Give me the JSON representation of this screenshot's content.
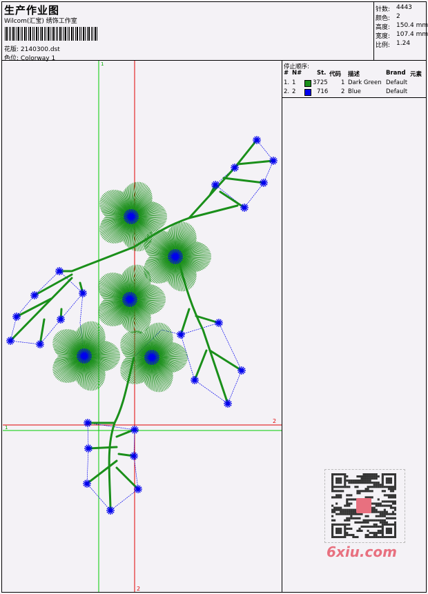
{
  "header": {
    "title": "生产作业图",
    "studio": "Wilcom(汇宝) 绣饰工作室",
    "design_label": "花版:",
    "design_value": "2140300.dst",
    "colorway_label": "色位:",
    "colorway_value": "Colorway 1"
  },
  "stats": [
    {
      "label": "针数:",
      "value": "4443"
    },
    {
      "label": "颜色:",
      "value": "2"
    },
    {
      "label": "高度:",
      "value": "150.4 mm"
    },
    {
      "label": "宽度:",
      "value": "107.4 mm"
    },
    {
      "label": "比例:",
      "value": "1.24"
    }
  ],
  "stop_sequence": {
    "title": "停止顺序:",
    "columns": [
      "#",
      "N#",
      "St.",
      "代码",
      "描述",
      "Brand",
      "元素"
    ],
    "rows": [
      {
        "idx": "1.",
        "n": "1",
        "stitches": "3725",
        "code": "1",
        "desc": "Dark Green",
        "brand": "Default",
        "color": "#1a8f1a"
      },
      {
        "idx": "2.",
        "n": "2",
        "stitches": "716",
        "code": "2",
        "desc": "Blue",
        "brand": "Default",
        "color": "#0000ee"
      }
    ]
  },
  "guides": {
    "green_label_top": "1",
    "green_label_left": "1",
    "red_label_right": "2",
    "red_label_bottom": "2"
  },
  "watermark": "6xiu.com",
  "colors": {
    "green": "#1a8f1a",
    "blue": "#0000ee",
    "red": "#e00000",
    "guide_green": "#00cc00"
  }
}
